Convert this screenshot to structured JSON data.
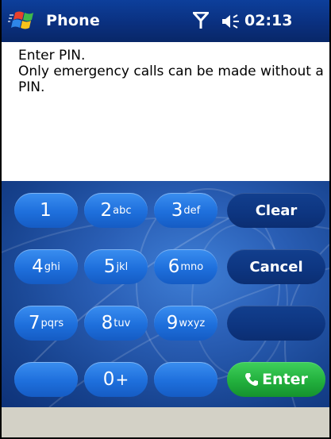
{
  "titlebar": {
    "app_title": "Phone",
    "clock": "02:13",
    "icons": [
      "windows-start-icon",
      "signal-antenna-icon",
      "speaker-volume-icon"
    ]
  },
  "message": {
    "lines": [
      "Enter PIN.",
      "Only emergency calls can be made without a",
      "PIN."
    ]
  },
  "keypad": {
    "keys": [
      {
        "digit": "1",
        "letters": ""
      },
      {
        "digit": "2",
        "letters": "abc"
      },
      {
        "digit": "3",
        "letters": "def"
      },
      {
        "digit": "4",
        "letters": "ghi"
      },
      {
        "digit": "5",
        "letters": "jkl"
      },
      {
        "digit": "6",
        "letters": "mno"
      },
      {
        "digit": "7",
        "letters": "pqrs"
      },
      {
        "digit": "8",
        "letters": "tuv"
      },
      {
        "digit": "9",
        "letters": "wxyz"
      },
      {
        "digit": "",
        "letters": ""
      },
      {
        "digit": "0",
        "letters": "+"
      },
      {
        "digit": "",
        "letters": ""
      }
    ],
    "clear_label": "Clear",
    "cancel_label": "Cancel",
    "blank_label": "",
    "enter_label": "Enter"
  },
  "colors": {
    "titlebar": "#0a2f7d",
    "key_blue": "#1e6fdc",
    "key_dark": "#0d3580",
    "enter_green": "#22b03d",
    "bottombar": "#d3d1c6"
  }
}
